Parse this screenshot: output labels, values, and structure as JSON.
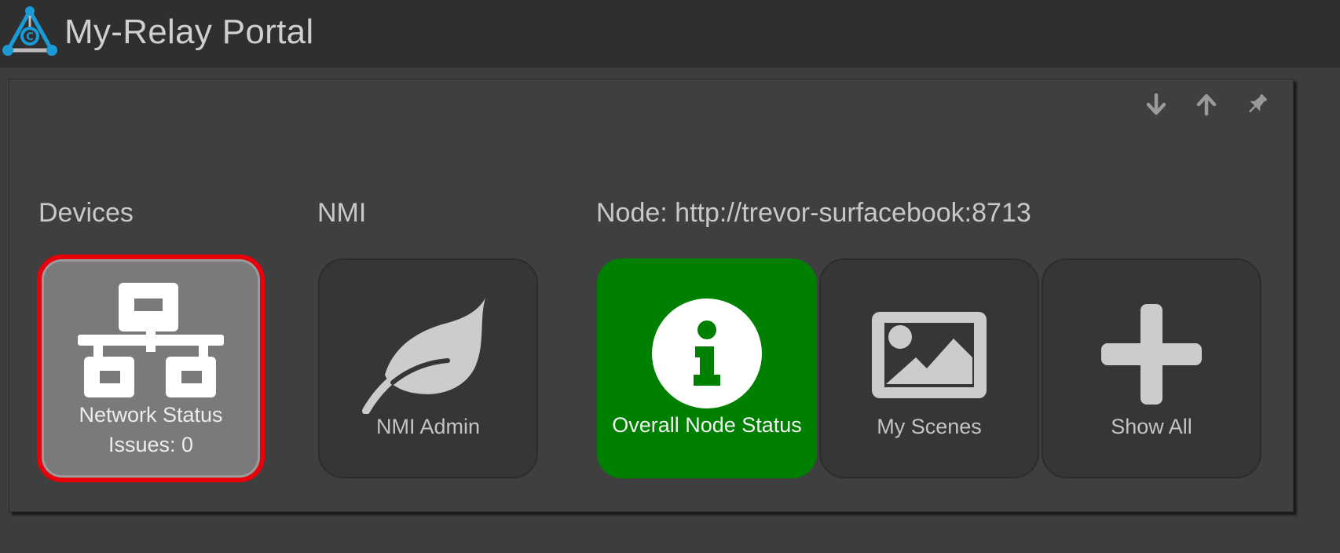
{
  "header": {
    "title": "My-Relay Portal",
    "logo_icon": "relay-triangle-logo-icon"
  },
  "panel": {
    "tools": [
      {
        "name": "move-down-icon",
        "glyph": "arrow-down"
      },
      {
        "name": "move-up-icon",
        "glyph": "arrow-up"
      },
      {
        "name": "pin-icon",
        "glyph": "pushpin"
      }
    ],
    "groups": {
      "devices": "Devices",
      "nmi": "NMI",
      "node": "Node: http://trevor-surfacebook:8713"
    },
    "tiles": {
      "network_status": {
        "label": "Network Status",
        "sublabel": "Issues: 0",
        "icon": "network-icon",
        "state": "selected"
      },
      "nmi_admin": {
        "label": "NMI Admin",
        "icon": "leaf-icon"
      },
      "overall_node_status": {
        "label": "Overall Node Status",
        "icon": "info-icon",
        "state": "ok"
      },
      "my_scenes": {
        "label": "My Scenes",
        "icon": "image-icon"
      },
      "show_all": {
        "label": "Show All",
        "icon": "plus-icon"
      }
    }
  },
  "colors": {
    "accent_logo": "#1a9bd7",
    "status_ok": "#008000",
    "selection_outline": "#e8000b",
    "background": "#3d3d3d",
    "header_background": "#2f2f2f"
  }
}
